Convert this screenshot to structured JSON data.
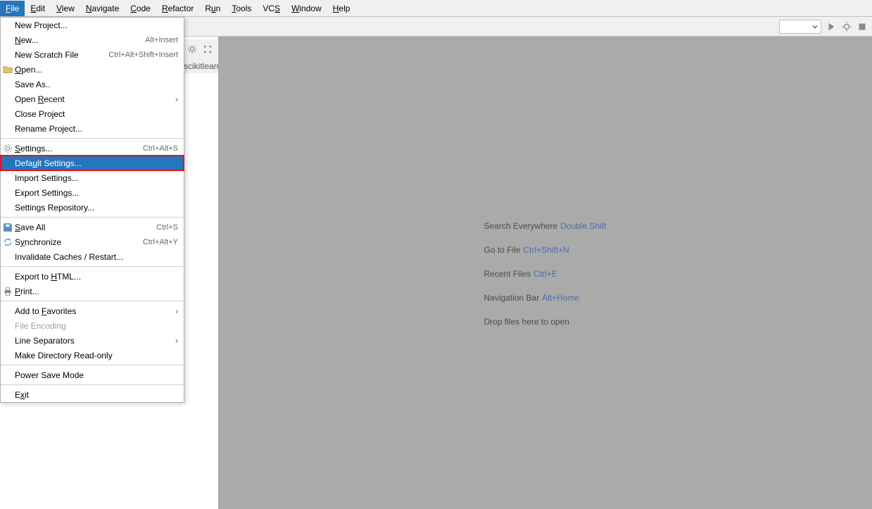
{
  "menubar": {
    "items": [
      {
        "label": "File",
        "mn": 0
      },
      {
        "label": "Edit",
        "mn": 0
      },
      {
        "label": "View",
        "mn": 0
      },
      {
        "label": "Navigate",
        "mn": 0
      },
      {
        "label": "Code",
        "mn": 0
      },
      {
        "label": "Refactor",
        "mn": 0
      },
      {
        "label": "Run",
        "mn": 1
      },
      {
        "label": "Tools",
        "mn": 0
      },
      {
        "label": "VCS",
        "mn": 2
      },
      {
        "label": "Window",
        "mn": 0
      },
      {
        "label": "Help",
        "mn": 0
      }
    ]
  },
  "file_menu": [
    {
      "label": "New Project..."
    },
    {
      "label": "New...",
      "mn": 0,
      "hotkey": "Alt+Insert"
    },
    {
      "label": "New Scratch File",
      "hotkey": "Ctrl+Alt+Shift+Insert"
    },
    {
      "label": "Open...",
      "mn": 0,
      "icon": "folder"
    },
    {
      "label": "Save As.."
    },
    {
      "label": "Open Recent",
      "mn": 5,
      "submenu": true
    },
    {
      "label": "Close Project"
    },
    {
      "label": "Rename Project..."
    },
    {
      "sep": true
    },
    {
      "label": "Settings...",
      "mn": 0,
      "hotkey": "Ctrl+Alt+S",
      "icon": "settings"
    },
    {
      "label": "Default Settings...",
      "mn": 4,
      "highlight": true
    },
    {
      "label": "Import Settings..."
    },
    {
      "label": "Export Settings..."
    },
    {
      "label": "Settings Repository..."
    },
    {
      "sep": true
    },
    {
      "label": "Save All",
      "mn": 0,
      "hotkey": "Ctrl+S",
      "icon": "save"
    },
    {
      "label": "Synchronize",
      "mn": 1,
      "hotkey": "Ctrl+Alt+Y",
      "icon": "sync"
    },
    {
      "label": "Invalidate Caches / Restart..."
    },
    {
      "sep": true
    },
    {
      "label": "Export to HTML...",
      "mn": 10
    },
    {
      "label": "Print...",
      "mn": 0,
      "icon": "print"
    },
    {
      "sep": true
    },
    {
      "label": "Add to Favorites",
      "mn": 7,
      "submenu": true
    },
    {
      "label": "File Encoding",
      "disabled": true
    },
    {
      "label": "Line Separators",
      "submenu": true
    },
    {
      "label": "Make Directory Read-only"
    },
    {
      "sep": true
    },
    {
      "label": "Power Save Mode"
    },
    {
      "sep": true
    },
    {
      "label": "Exit",
      "mn": 1
    }
  ],
  "breadcrumb": "scikitlearn",
  "tips": {
    "search_label": "Search Everywhere",
    "search_key": "Double Shift",
    "goto_label": "Go to File",
    "goto_key": "Ctrl+Shift+N",
    "recent_label": "Recent Files",
    "recent_key": "Ctrl+E",
    "navbar_label": "Navigation Bar",
    "navbar_key": "Alt+Home",
    "drop_label": "Drop files here to open"
  }
}
